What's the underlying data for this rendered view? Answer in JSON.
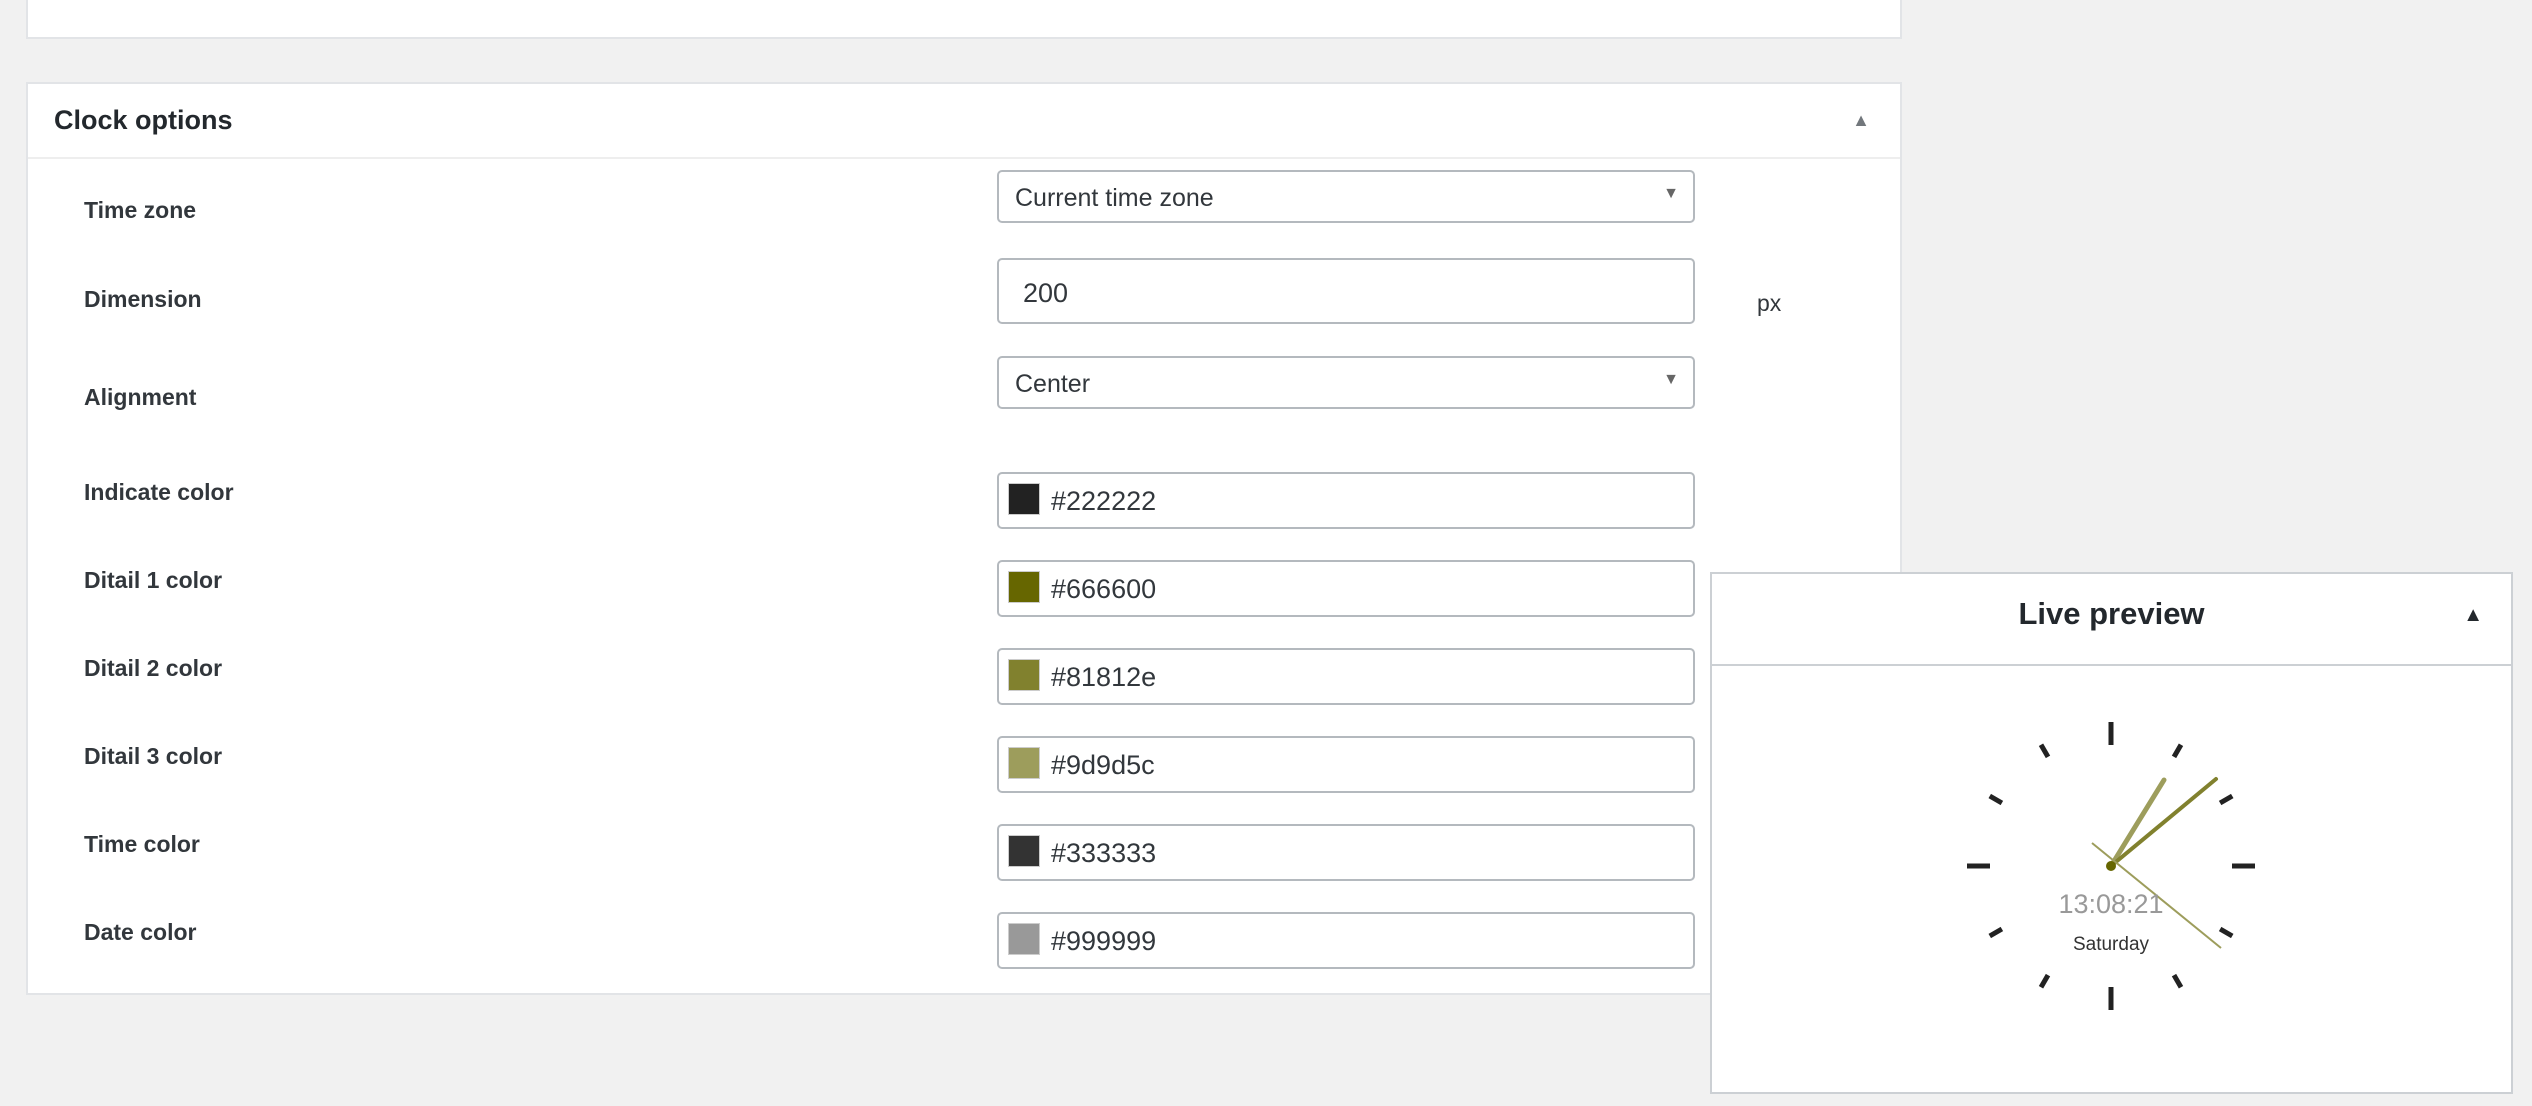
{
  "clock_options": {
    "title": "Clock options",
    "rows": [
      {
        "label": "Time zone",
        "type": "select",
        "value": "Current time zone"
      },
      {
        "label": "Dimension",
        "type": "input",
        "value": "200",
        "unit": "px"
      },
      {
        "label": "Alignment",
        "type": "select",
        "value": "Center"
      },
      {
        "label": "Indicate color",
        "type": "color",
        "value": "#222222"
      },
      {
        "label": "Ditail 1 color",
        "type": "color",
        "value": "#666600"
      },
      {
        "label": "Ditail 2 color",
        "type": "color",
        "value": "#81812e"
      },
      {
        "label": "Ditail 3 color",
        "type": "color",
        "value": "#9d9d5c"
      },
      {
        "label": "Time color",
        "type": "color",
        "value": "#333333"
      },
      {
        "label": "Date color",
        "type": "color",
        "value": "#999999"
      }
    ]
  },
  "live_preview": {
    "title": "Live preview",
    "time": "13:08:21",
    "date": "Saturday"
  },
  "icons": {
    "collapse": "triangle-up-icon",
    "dropdown": "triangle-down-icon"
  }
}
